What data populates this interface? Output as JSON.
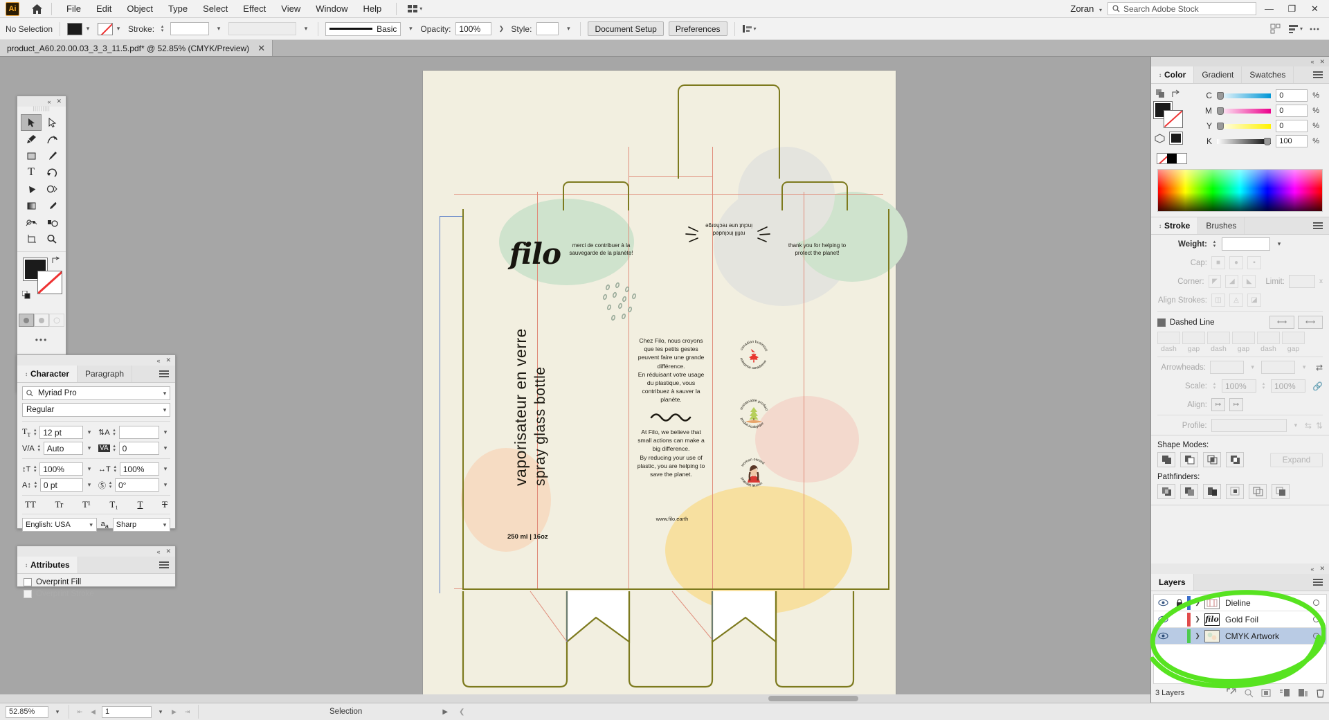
{
  "app": {
    "logo_text": "Ai",
    "menus": [
      "File",
      "Edit",
      "Object",
      "Type",
      "Select",
      "Effect",
      "View",
      "Window",
      "Help"
    ],
    "workspace": "Zoran",
    "search_placeholder": "Search Adobe Stock",
    "window_buttons": {
      "minimize": "—",
      "maximize": "❐",
      "close": "✕"
    }
  },
  "control_bar": {
    "selection_status": "No Selection",
    "stroke_label": "Stroke:",
    "stroke_weight": "",
    "brush_name": "Basic",
    "opacity_label": "Opacity:",
    "opacity_value": "100%",
    "style_label": "Style:",
    "document_setup": "Document Setup",
    "preferences": "Preferences"
  },
  "document_tab": {
    "title": "product_A60.20.00.03_3_3_11.5.pdf* @ 52.85% (CMYK/Preview)",
    "close": "✕"
  },
  "toolbar": {
    "tools": [
      "selection-tool",
      "direct-selection-tool",
      "pen-tool",
      "curvature-tool",
      "rectangle-tool",
      "paintbrush-tool",
      "type-tool",
      "rotate-tool",
      "shaper-tool",
      "width-tool",
      "gradient-tool",
      "eyedropper-tool",
      "blend-tool",
      "symbol-sprayer-tool",
      "artboard-tool",
      "zoom-tool"
    ],
    "fill_color": "#1b1b1b",
    "stroke_color": "none",
    "more_tools": "•••"
  },
  "character_panel": {
    "tabs": [
      "Character",
      "Paragraph"
    ],
    "active_tab": "Character",
    "font_family": "Myriad Pro",
    "font_style": "Regular",
    "font_size": "12 pt",
    "leading": "Auto",
    "vertical_scale_icon_value": "",
    "tracking": "0",
    "horizontal_scale": "100%",
    "vertical_scale": "100%",
    "baseline_shift": "0 pt",
    "rotation": "0°",
    "language": "English: USA",
    "anti_alias": "Sharp",
    "style_buttons": [
      "TT",
      "Tr",
      "T¹",
      "T₁",
      "T",
      "Ŧ"
    ]
  },
  "attributes_panel": {
    "title": "Attributes",
    "overprint_fill": "Overprint Fill",
    "overprint_stroke": "Overprint Stroke"
  },
  "color_panel": {
    "tabs": [
      "Color",
      "Gradient",
      "Swatches"
    ],
    "active_tab": "Color",
    "channels": [
      {
        "label": "C",
        "value": "0",
        "unit": "%",
        "pct": 0,
        "track": "linear-gradient(to right,#ffffff,#0096d6)"
      },
      {
        "label": "M",
        "value": "0",
        "unit": "%",
        "pct": 0,
        "track": "linear-gradient(to right,#ffffff,#ec008c)"
      },
      {
        "label": "Y",
        "value": "0",
        "unit": "%",
        "pct": 0,
        "track": "linear-gradient(to right,#ffffff,#fff200)"
      },
      {
        "label": "K",
        "value": "100",
        "unit": "%",
        "pct": 100,
        "track": "linear-gradient(to right,#ffffff,#000000)"
      }
    ],
    "fill_color": "#1b1b1b"
  },
  "stroke_panel": {
    "tabs": [
      "Stroke",
      "Brushes"
    ],
    "active_tab": "Stroke",
    "weight_label": "Weight:",
    "weight_value": "",
    "cap_label": "Cap:",
    "corner_label": "Corner:",
    "limit_label": "Limit:",
    "limit_unit": "x",
    "align_label": "Align Strokes:",
    "dashed_line_label": "Dashed Line",
    "dash_labels": [
      "dash",
      "gap",
      "dash",
      "gap",
      "dash",
      "gap"
    ],
    "arrowheads_label": "Arrowheads:",
    "scale_label": "Scale:",
    "scale_values": [
      "100%",
      "100%"
    ],
    "align_row_label": "Align:",
    "profile_label": "Profile:"
  },
  "pathfinder_panel": {
    "shape_modes_label": "Shape Modes:",
    "expand_label": "Expand",
    "pathfinders_label": "Pathfinders:"
  },
  "layers_panel": {
    "title": "Layers",
    "rows": [
      {
        "name": "Dieline",
        "visible": true,
        "locked": true,
        "color": "#3a6ecb",
        "selected": false
      },
      {
        "name": "Gold Foil",
        "visible": true,
        "locked": false,
        "color": "#e14b4b",
        "selected": false
      },
      {
        "name": "CMYK Artwork",
        "visible": true,
        "locked": false,
        "color": "#4ecb4e",
        "selected": true
      }
    ],
    "count_label": "3 Layers",
    "annotation_color": "#57e320"
  },
  "status_bar": {
    "zoom": "52.85%",
    "page": "1",
    "tool_status": "Selection"
  },
  "artwork": {
    "brand": "filo",
    "product_fr": "vaporisateur en verre",
    "product_en": "spray glass bottle",
    "volume": "250 ml | 16oz",
    "website": "www.filo.earth",
    "body_fr": [
      "Chez Filo, nous croyons",
      "que les petits gestes",
      "peuvent faire une grande",
      "différence.",
      "En réduisant votre usage",
      "du plastique, vous",
      "contribuez à sauver la",
      "planète."
    ],
    "body_en": [
      "At Filo, we believe that",
      "small actions can make a",
      "big difference.",
      "By reducing your use of",
      "plastic, you are helping to",
      "save the planet."
    ],
    "flap_left": [
      "merci de contribuer à la",
      "sauvegarde de la planète!"
    ],
    "flap_right": [
      "thank you for helping to",
      "protect the planet!"
    ],
    "flap_top": [
      "refill included",
      "inclut une recharge"
    ],
    "badges": [
      {
        "top": "canadian business",
        "bottom": "entreprise canadienne",
        "icon": "maple-leaf-icon"
      },
      {
        "top": "sustainable product",
        "bottom": "produit écologique",
        "icon": "tree-icon"
      },
      {
        "top": "woman owned",
        "bottom": "propriété féminin",
        "icon": "woman-icon"
      }
    ],
    "colors": {
      "paper": "#f2efe0",
      "dieline": "#7d7a1e",
      "guide": "#e08c7a",
      "mint": "#cfe3cd",
      "peach": "#f6dcc3",
      "yellow": "#f7e0a0",
      "gray": "#e2e2de",
      "rose": "#f3d9cd"
    }
  }
}
